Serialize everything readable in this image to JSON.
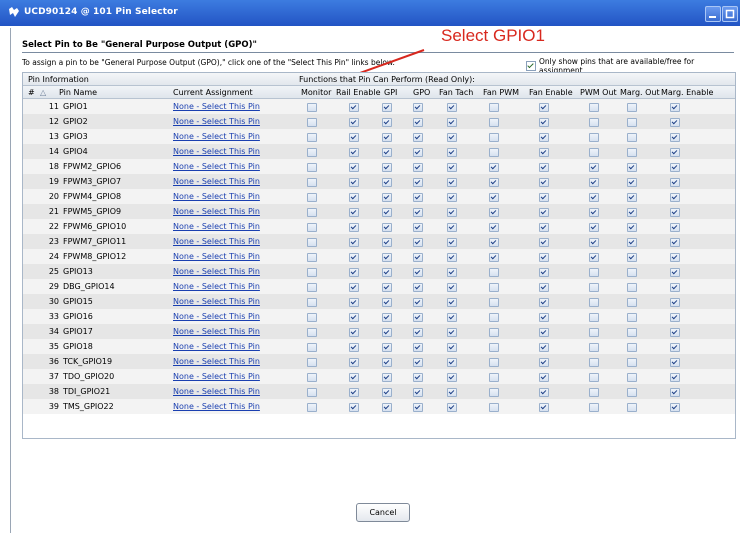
{
  "window": {
    "title": "UCD90124 @ 101 Pin Selector"
  },
  "heading": "Select Pin to Be \"General Purpose Output (GPO)\"",
  "instructions": "To assign a pin to be \"General Purpose Output (GPO),\" click one of the \"Select This Pin\" links below.",
  "only_show_label": "Only show pins that are available/free for assignment",
  "annotation": "Select GPIO1",
  "grid": {
    "group_left": "Pin Information",
    "group_right": "Functions that Pin Can Perform (Read Only):",
    "headers": [
      "#",
      "△",
      "Pin Name",
      "Current Assignment",
      "Monitor",
      "Rail Enable",
      "GPI",
      "GPO",
      "Fan Tach",
      "Fan PWM",
      "Fan Enable",
      "PWM Out",
      "Marg. Out",
      "Marg. Enable"
    ],
    "rows": [
      {
        "no": "11",
        "name": "GPIO1",
        "assign": "None - Select This Pin",
        "f": [
          0,
          1,
          1,
          1,
          1,
          0,
          1,
          0,
          0,
          1
        ]
      },
      {
        "no": "12",
        "name": "GPIO2",
        "assign": "None - Select This Pin",
        "f": [
          0,
          1,
          1,
          1,
          1,
          0,
          1,
          0,
          0,
          1
        ]
      },
      {
        "no": "13",
        "name": "GPIO3",
        "assign": "None - Select This Pin",
        "f": [
          0,
          1,
          1,
          1,
          1,
          0,
          1,
          0,
          0,
          1
        ]
      },
      {
        "no": "14",
        "name": "GPIO4",
        "assign": "None - Select This Pin",
        "f": [
          0,
          1,
          1,
          1,
          1,
          0,
          1,
          0,
          0,
          1
        ]
      },
      {
        "no": "18",
        "name": "FPWM2_GPIO6",
        "assign": "None - Select This Pin",
        "f": [
          0,
          1,
          1,
          1,
          1,
          1,
          1,
          1,
          1,
          1
        ]
      },
      {
        "no": "19",
        "name": "FPWM3_GPIO7",
        "assign": "None - Select This Pin",
        "f": [
          0,
          1,
          1,
          1,
          1,
          1,
          1,
          1,
          1,
          1
        ]
      },
      {
        "no": "20",
        "name": "FPWM4_GPIO8",
        "assign": "None - Select This Pin",
        "f": [
          0,
          1,
          1,
          1,
          1,
          1,
          1,
          1,
          1,
          1
        ]
      },
      {
        "no": "21",
        "name": "FPWM5_GPIO9",
        "assign": "None - Select This Pin",
        "f": [
          0,
          1,
          1,
          1,
          1,
          1,
          1,
          1,
          1,
          1
        ]
      },
      {
        "no": "22",
        "name": "FPWM6_GPIO10",
        "assign": "None - Select This Pin",
        "f": [
          0,
          1,
          1,
          1,
          1,
          1,
          1,
          1,
          1,
          1
        ]
      },
      {
        "no": "23",
        "name": "FPWM7_GPIO11",
        "assign": "None - Select This Pin",
        "f": [
          0,
          1,
          1,
          1,
          1,
          1,
          1,
          1,
          1,
          1
        ]
      },
      {
        "no": "24",
        "name": "FPWM8_GPIO12",
        "assign": "None - Select This Pin",
        "f": [
          0,
          1,
          1,
          1,
          1,
          1,
          1,
          1,
          1,
          1
        ]
      },
      {
        "no": "25",
        "name": "GPIO13",
        "assign": "None - Select This Pin",
        "f": [
          0,
          1,
          1,
          1,
          1,
          0,
          1,
          0,
          0,
          1
        ]
      },
      {
        "no": "29",
        "name": "DBG_GPIO14",
        "assign": "None - Select This Pin",
        "f": [
          0,
          1,
          1,
          1,
          1,
          0,
          1,
          0,
          0,
          1
        ]
      },
      {
        "no": "30",
        "name": "GPIO15",
        "assign": "None - Select This Pin",
        "f": [
          0,
          1,
          1,
          1,
          1,
          0,
          1,
          0,
          0,
          1
        ]
      },
      {
        "no": "33",
        "name": "GPIO16",
        "assign": "None - Select This Pin",
        "f": [
          0,
          1,
          1,
          1,
          1,
          0,
          1,
          0,
          0,
          1
        ]
      },
      {
        "no": "34",
        "name": "GPIO17",
        "assign": "None - Select This Pin",
        "f": [
          0,
          1,
          1,
          1,
          1,
          0,
          1,
          0,
          0,
          1
        ]
      },
      {
        "no": "35",
        "name": "GPIO18",
        "assign": "None - Select This Pin",
        "f": [
          0,
          1,
          1,
          1,
          1,
          0,
          1,
          0,
          0,
          1
        ]
      },
      {
        "no": "36",
        "name": "TCK_GPIO19",
        "assign": "None - Select This Pin",
        "f": [
          0,
          1,
          1,
          1,
          1,
          0,
          1,
          0,
          0,
          1
        ]
      },
      {
        "no": "37",
        "name": "TDO_GPIO20",
        "assign": "None - Select This Pin",
        "f": [
          0,
          1,
          1,
          1,
          1,
          0,
          1,
          0,
          0,
          1
        ]
      },
      {
        "no": "38",
        "name": "TDI_GPIO21",
        "assign": "None - Select This Pin",
        "f": [
          0,
          1,
          1,
          1,
          1,
          0,
          1,
          0,
          0,
          1
        ]
      },
      {
        "no": "39",
        "name": "TMS_GPIO22",
        "assign": "None - Select This Pin",
        "f": [
          0,
          1,
          1,
          1,
          1,
          0,
          1,
          0,
          0,
          1
        ]
      }
    ]
  },
  "cancel_label": "Cancel",
  "colors": {
    "titlebar": "#2a60cc",
    "link": "#1a3fb0",
    "annotation": "#d8281e"
  },
  "icons": [
    "app-icon",
    "minimize-icon",
    "maximize-icon",
    "checkbox-icon",
    "sort-ascending-icon"
  ]
}
